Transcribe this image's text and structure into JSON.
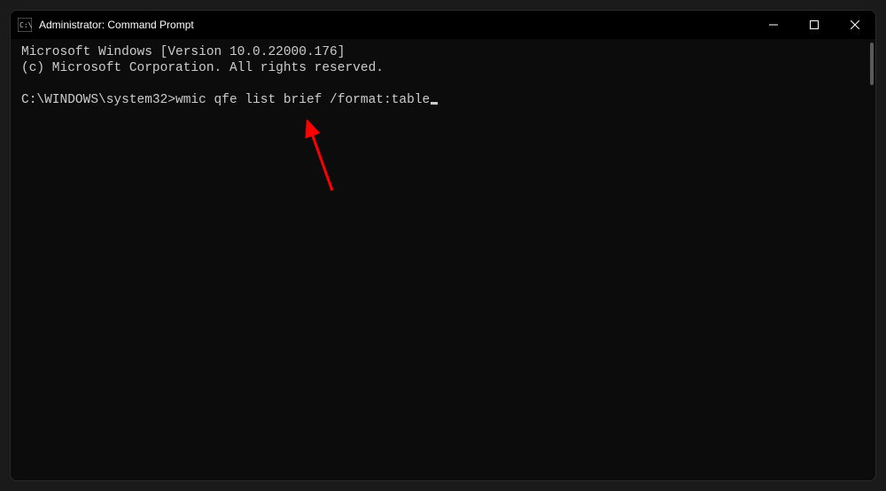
{
  "titlebar": {
    "title": "Administrator: Command Prompt"
  },
  "terminal": {
    "line1": "Microsoft Windows [Version 10.0.22000.176]",
    "line2": "(c) Microsoft Corporation. All rights reserved.",
    "prompt": "C:\\WINDOWS\\system32>",
    "command": "wmic qfe list brief /format:table"
  }
}
